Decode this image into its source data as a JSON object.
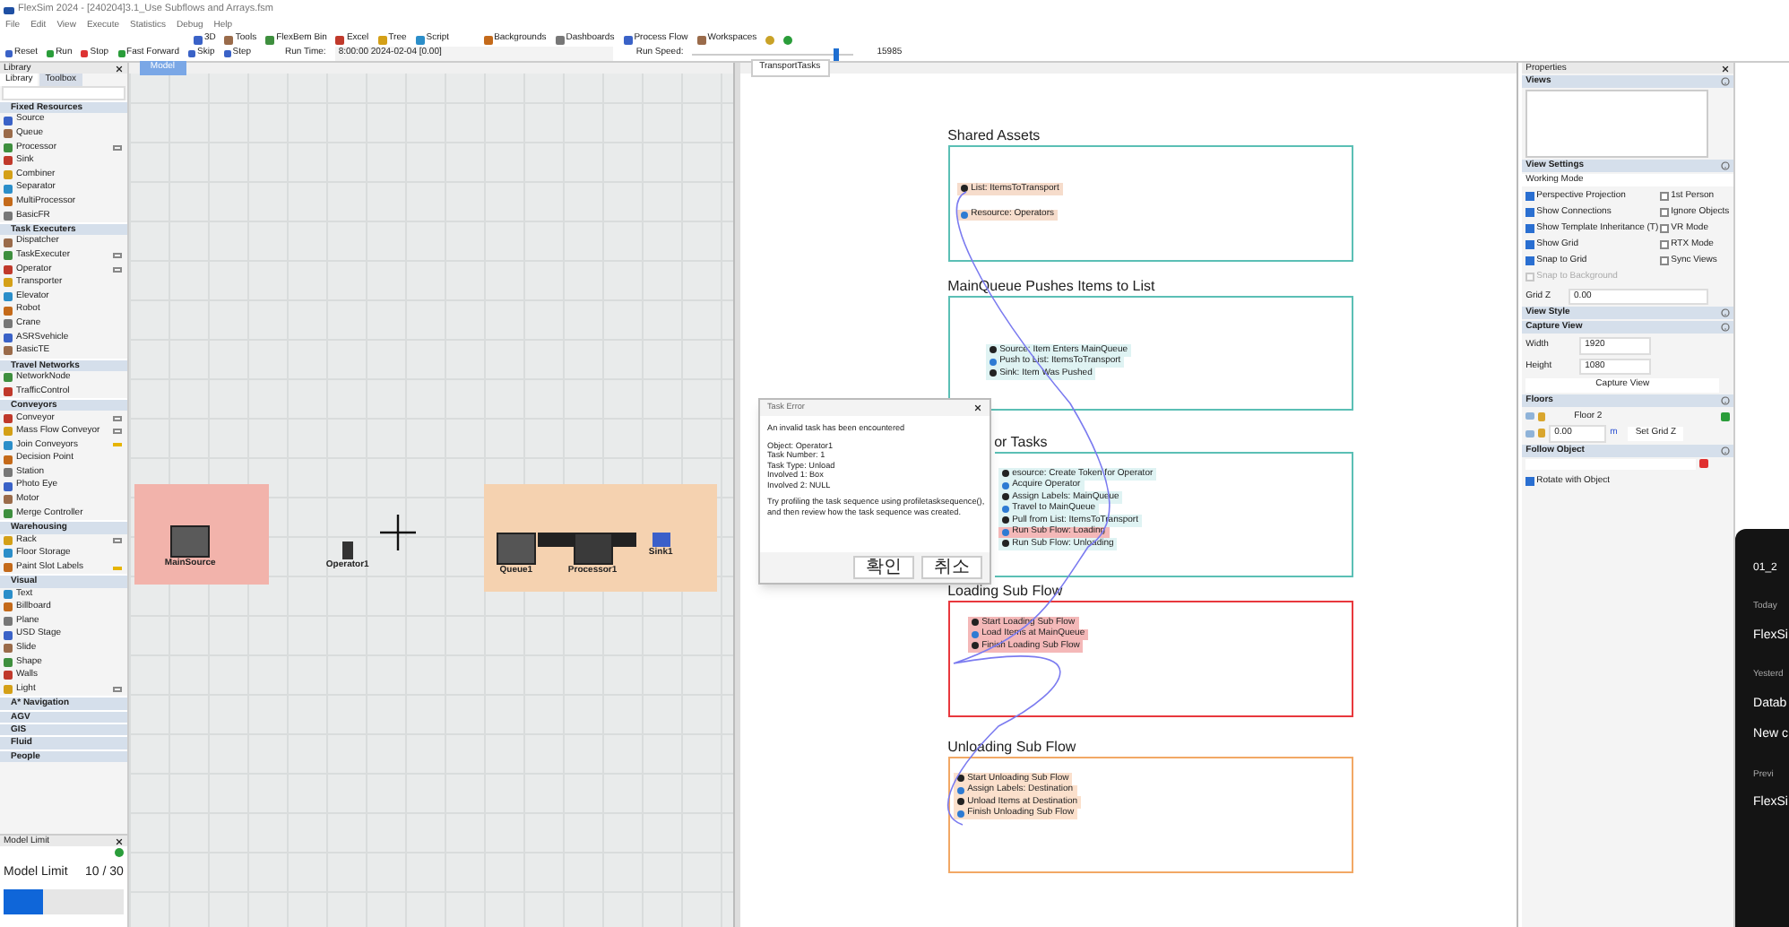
{
  "window": {
    "title": "FlexSim 2024 - [240204]3.1_Use Subflows and Arrays.fsm"
  },
  "menu": [
    "File",
    "Edit",
    "View",
    "Execute",
    "Statistics",
    "Debug",
    "Help"
  ],
  "toolbar": [
    "3D",
    "Tools",
    "FlexBem Bin",
    "Excel",
    "Tree",
    "Script",
    "Backgrounds",
    "Dashboards",
    "Process Flow",
    "Workspaces"
  ],
  "run_bar": {
    "buttons": [
      "Reset",
      "Run",
      "Stop",
      "Fast Forward",
      "Skip",
      "Step"
    ],
    "run_time_label": "Run Time:",
    "run_time": "8:00:00  2024-02-04  [0.00]",
    "run_speed_label": "Run Speed:",
    "speed": {
      "level": 0.9
    },
    "run_speed": "15985"
  },
  "library": {
    "title": "Library",
    "tabs": [
      {
        "label": "Library",
        "selected": true
      },
      {
        "label": "Toolbox",
        "selected": false
      }
    ],
    "groups": [
      {
        "title": "Fixed Resources",
        "items": [
          {
            "label": "Source",
            "kind": "plain"
          },
          {
            "label": "Queue",
            "kind": "plain"
          },
          {
            "label": "Processor",
            "kind": "window"
          },
          {
            "label": "Sink",
            "kind": "plain"
          },
          {
            "label": "Combiner",
            "kind": "plain"
          },
          {
            "label": "Separator",
            "kind": "plain"
          },
          {
            "label": "MultiProcessor",
            "kind": "plain"
          },
          {
            "label": "BasicFR",
            "kind": "plain"
          }
        ]
      },
      {
        "title": "Task Executers",
        "items": [
          {
            "label": "Dispatcher",
            "kind": "plain"
          },
          {
            "label": "TaskExecuter",
            "kind": "window"
          },
          {
            "label": "Operator",
            "kind": "window"
          },
          {
            "label": "Transporter",
            "kind": "plain"
          },
          {
            "label": "Elevator",
            "kind": "plain"
          },
          {
            "label": "Robot",
            "kind": "plain"
          },
          {
            "label": "Crane",
            "kind": "plain"
          },
          {
            "label": "ASRSvehicle",
            "kind": "plain"
          },
          {
            "label": "BasicTE",
            "kind": "plain"
          }
        ]
      },
      {
        "title": "Travel Networks",
        "items": [
          {
            "label": "NetworkNode",
            "kind": "plain"
          },
          {
            "label": "TrafficControl",
            "kind": "plain"
          }
        ]
      },
      {
        "title": "Conveyors",
        "items": [
          {
            "label": "Conveyor",
            "kind": "window"
          },
          {
            "label": "Mass Flow Conveyor",
            "kind": "window"
          },
          {
            "label": "Join Conveyors",
            "kind": "brush"
          },
          {
            "label": "Decision Point",
            "kind": "plain"
          },
          {
            "label": "Station",
            "kind": "plain"
          },
          {
            "label": "Photo Eye",
            "kind": "plain"
          },
          {
            "label": "Motor",
            "kind": "plain"
          },
          {
            "label": "Merge Controller",
            "kind": "plain"
          }
        ]
      },
      {
        "title": "Warehousing",
        "items": [
          {
            "label": "Rack",
            "kind": "window"
          },
          {
            "label": "Floor Storage",
            "kind": "plain"
          },
          {
            "label": "Paint Slot Labels",
            "kind": "brush"
          }
        ]
      },
      {
        "title": "Visual",
        "items": [
          {
            "label": "Text",
            "kind": "plain"
          },
          {
            "label": "Billboard",
            "kind": "plain"
          },
          {
            "label": "Plane",
            "kind": "plain"
          },
          {
            "label": "USD Stage",
            "kind": "plain"
          },
          {
            "label": "Slide",
            "kind": "plain"
          },
          {
            "label": "Shape",
            "kind": "plain"
          },
          {
            "label": "Walls",
            "kind": "plain"
          },
          {
            "label": "Light",
            "kind": "window"
          }
        ]
      },
      {
        "title": "A* Navigation"
      },
      {
        "title": "AGV"
      },
      {
        "title": "GIS"
      },
      {
        "title": "Fluid"
      },
      {
        "title": "People"
      }
    ]
  },
  "model_limit": {
    "title": "Model Limit",
    "label": "Model Limit",
    "count": "10 / 30",
    "level": 0.33
  },
  "model_view": {
    "tab": "Model",
    "objects": [
      {
        "label": "MainSource",
        "kind": "source"
      },
      {
        "label": "Operator1",
        "kind": "operator"
      },
      {
        "label": "Queue1",
        "kind": "queue"
      },
      {
        "label": "Processor1",
        "kind": "processor"
      },
      {
        "label": "Sink1",
        "kind": "sink"
      }
    ]
  },
  "process_flow": {
    "tab": "TransportTasks",
    "blocks": [
      {
        "title": "Shared Assets",
        "color": "#5bbfb5",
        "activities": [
          {
            "label": "List: ItemsToTransport",
            "color": "#f6dccb"
          },
          {
            "label": "Resource: Operators",
            "color": "#f6dccb"
          }
        ]
      },
      {
        "title": "MainQueue Pushes Items to List",
        "color": "#5bbfb5",
        "activities": [
          {
            "label": "Source: Item Enters MainQueue",
            "color": "#dff3f3"
          },
          {
            "label": "Push to List: ItemsToTransport",
            "color": "#dff3f3"
          },
          {
            "label": "Sink: Item Was Pushed",
            "color": "#dff3f3"
          }
        ]
      },
      {
        "title": "or Tasks",
        "color": "#5bbfb5",
        "activities": [
          {
            "label": "esource: Create Token for Operator",
            "color": "#dff3f3"
          },
          {
            "label": "Acquire Operator",
            "color": "#dff3f3"
          },
          {
            "label": "Assign Labels: MainQueue",
            "color": "#dff3f3"
          },
          {
            "label": "Travel to MainQueue",
            "color": "#dff3f3"
          },
          {
            "label": "Pull from List: ItemsToTransport",
            "color": "#dff3f3"
          },
          {
            "label": "Run Sub Flow: Loading",
            "color": "#f4b8b8"
          },
          {
            "label": "Run Sub Flow: Unloading",
            "color": "#dff3f3"
          }
        ]
      },
      {
        "title": "Loading Sub Flow",
        "color": "#e8383d",
        "activities": [
          {
            "label": "Start Loading Sub Flow",
            "color": "#f4b8b8"
          },
          {
            "label": "Load Items at MainQueue",
            "color": "#f4b8b8"
          },
          {
            "label": "Finish Loading Sub Flow",
            "color": "#f4b8b8"
          }
        ]
      },
      {
        "title": "Unloading Sub Flow",
        "color": "#f2a865",
        "activities": [
          {
            "label": "Start Unloading Sub Flow",
            "color": "#fbe0cc"
          },
          {
            "label": "Assign Labels: Destination",
            "color": "#fbe0cc"
          },
          {
            "label": "Unload Items at Destination",
            "color": "#fbe0cc"
          },
          {
            "label": "Finish Unloading Sub Flow",
            "color": "#fbe0cc"
          }
        ]
      }
    ]
  },
  "dialog": {
    "title": "Task Error",
    "paragraphs": [
      [
        "An invalid task has been encountered"
      ],
      [
        "Object: Operator1",
        "Task Number: 1",
        "Task Type: Unload",
        "Involved 1: Box",
        "Involved 2: NULL"
      ],
      [
        "Try profiling the task sequence using profiletasksequence(),",
        "and then review how the task sequence was created."
      ]
    ],
    "buttons": [
      "확인",
      "취소"
    ]
  },
  "properties": {
    "title": "Properties",
    "views_title": "Views",
    "view_settings_title": "View Settings",
    "working_mode": "Working Mode",
    "checks": [
      {
        "label": "Perspective Projection",
        "checked": true
      },
      {
        "label": "1st Person",
        "checked": false
      },
      {
        "label": "Show Connections",
        "checked": true
      },
      {
        "label": "Ignore Objects",
        "checked": false
      },
      {
        "label": "Show Template Inheritance (T)",
        "checked": true
      },
      {
        "label": "VR Mode",
        "checked": false
      },
      {
        "label": "Show Grid",
        "checked": true
      },
      {
        "label": "RTX Mode",
        "checked": false
      },
      {
        "label": "Snap to Grid",
        "checked": true
      },
      {
        "label": "Sync Views",
        "checked": false
      }
    ],
    "snap_background": {
      "label": "Snap to Background",
      "checked": false,
      "disabled": true
    },
    "grid_z": {
      "label": "Grid Z",
      "value": "0.00"
    },
    "view_style_title": "View Style",
    "capture_title": "Capture View",
    "width": {
      "label": "Width",
      "value": "1920"
    },
    "height": {
      "label": "Height",
      "value": "1080"
    },
    "capture_button": "Capture View",
    "floors_title": "Floors",
    "floor_name": "Floor 2",
    "floor_z": "0.00",
    "floor_unit": "m",
    "set_grid": "Set Grid Z",
    "follow_title": "Follow Object",
    "rotate": {
      "label": "Rotate with Object",
      "checked": true
    }
  },
  "side_panel": {
    "top": "01_2",
    "items": [
      {
        "label": "Today",
        "kind": "heading"
      },
      {
        "label": "FlexSi",
        "kind": "chat"
      },
      {
        "label": "Yesterd",
        "kind": "heading"
      },
      {
        "label": "Datab",
        "kind": "chat"
      },
      {
        "label": "New c",
        "kind": "chat"
      },
      {
        "label": "Previ",
        "kind": "heading"
      },
      {
        "label": "FlexSi",
        "kind": "chat"
      }
    ]
  }
}
